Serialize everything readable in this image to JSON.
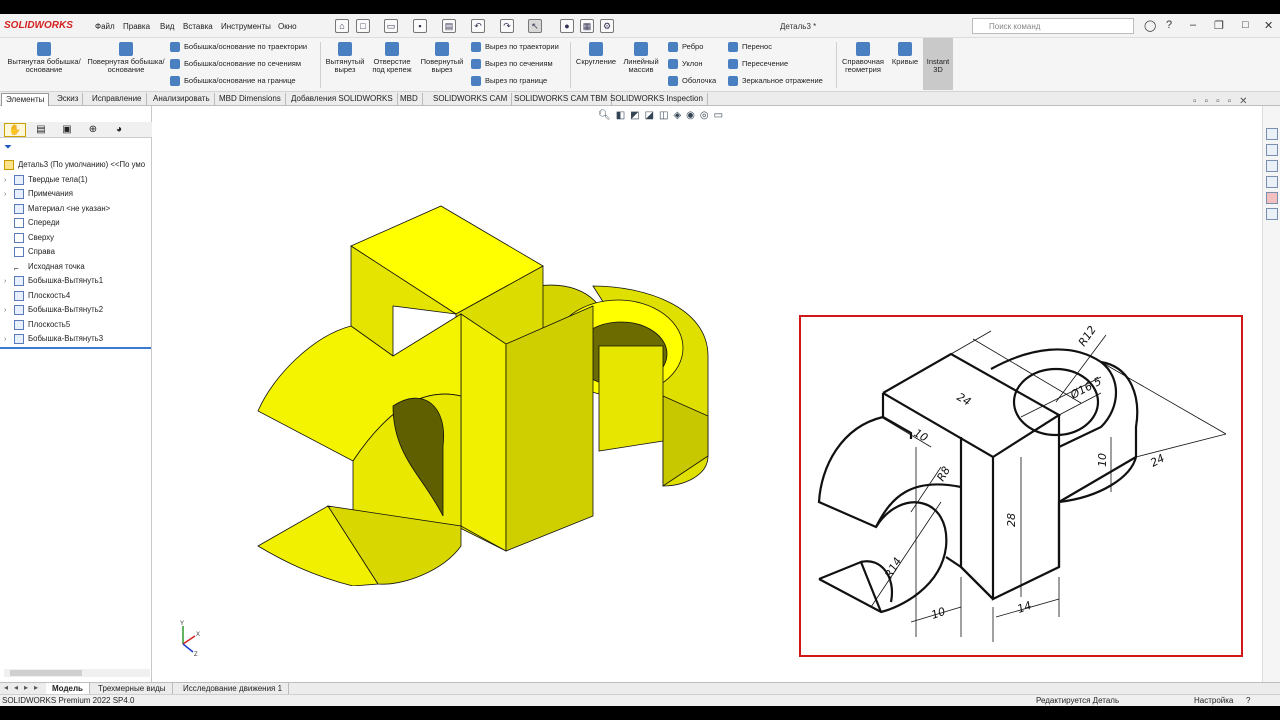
{
  "app": {
    "brand": "SOLIDWORKS",
    "document_title": "Деталь3 *",
    "search_placeholder": "Поиск команд"
  },
  "menu": [
    "Файл",
    "Правка",
    "Вид",
    "Вставка",
    "Инструменты",
    "Окно"
  ],
  "ribbon": {
    "extruded_boss": "Вытянутая бобышка/основание",
    "revolved_boss": "Повернутая бобышка/основание",
    "swept_boss": "Бобышка/основание по траектории",
    "lofted_boss": "Бобышка/основание по сечениям",
    "boundary_boss": "Бобышка/основание на границе",
    "extruded_cut": "Вытянутый вырез",
    "hole_wizard": "Отверстие под крепеж",
    "revolved_cut": "Повернутый вырез",
    "swept_cut": "Вырез по траектории",
    "lofted_cut": "Вырез по сечениям",
    "boundary_cut": "Вырез по границе",
    "fillet": "Скругление",
    "linear_pattern": "Линейный массив",
    "rib": "Ребро",
    "draft": "Уклон",
    "shell": "Оболочка",
    "wrap": "Перенос",
    "intersect": "Пересечение",
    "mirror": "Зеркальное отражение",
    "ref_geometry": "Справочная геометрия",
    "curves": "Кривые",
    "instant3d": "Instant 3D"
  },
  "tabs": [
    "Элементы",
    "Эскиз",
    "Исправление",
    "Анализировать",
    "MBD Dimensions",
    "Добавления SOLIDWORKS",
    "MBD",
    "SOLIDWORKS CAM",
    "SOLIDWORKS CAM TBM",
    "SOLIDWORKS Inspection"
  ],
  "tree": {
    "root": "Деталь3  (По умолчанию) <<По умо",
    "items": [
      {
        "label": "Твердые тела(1)",
        "expandable": true
      },
      {
        "label": "Примечания",
        "expandable": true
      },
      {
        "label": "Материал <не указан>",
        "expandable": false
      },
      {
        "label": "Спереди",
        "expandable": false
      },
      {
        "label": "Сверху",
        "expandable": false
      },
      {
        "label": "Справа",
        "expandable": false
      },
      {
        "label": "Исходная точка",
        "expandable": false
      },
      {
        "label": "Бобышка-Вытянуть1",
        "expandable": true
      },
      {
        "label": "Плоскость4",
        "expandable": false
      },
      {
        "label": "Бобышка-Вытянуть2",
        "expandable": true
      },
      {
        "label": "Плоскость5",
        "expandable": false
      },
      {
        "label": "Бобышка-Вытянуть3",
        "expandable": true
      }
    ]
  },
  "bottom_tabs": [
    "Модель",
    "Трехмерные виды",
    "Исследование движения 1"
  ],
  "status": {
    "version": "SOLIDWORKS Premium 2022 SP4.0",
    "editing": "Редактируется Деталь",
    "settings": "Настройка"
  },
  "drawing_dims": [
    "R12",
    "24",
    "Ø16.5",
    "10",
    "24",
    "R8",
    "10",
    "28",
    "R14",
    "10",
    "14"
  ],
  "colors": {
    "model_yellow": "#ffff00",
    "frame_red": "#d01818"
  }
}
